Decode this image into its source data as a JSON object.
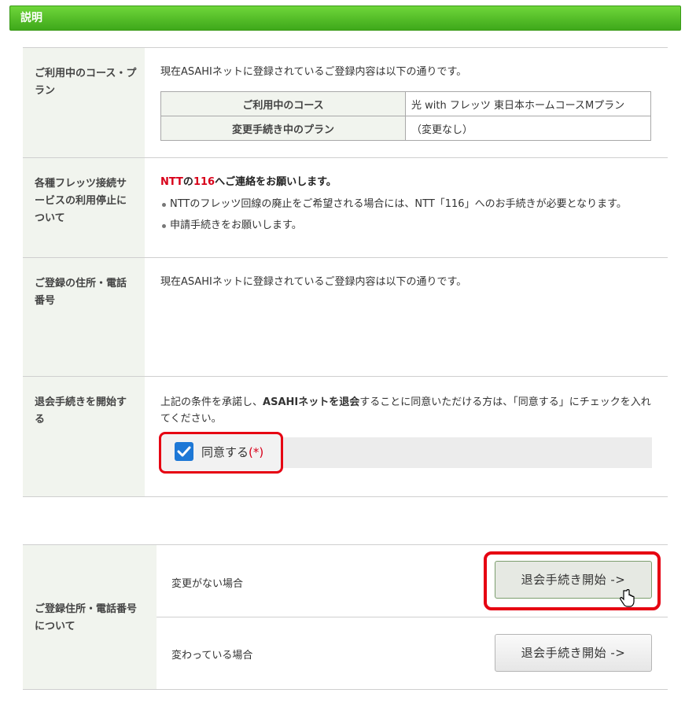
{
  "header": {
    "title": "説明"
  },
  "course": {
    "label": "ご利用中のコース・プラン",
    "intro": "現在ASAHIネットに登録されているご登録内容は以下の通りです。",
    "table": [
      {
        "key": "ご利用中のコース",
        "value": "光 with フレッツ 東日本ホームコースMプラン"
      },
      {
        "key": "変更手続き中のプラン",
        "value": "（変更なし）"
      }
    ]
  },
  "flets": {
    "label": "各種フレッツ接続サービスの利用停止について",
    "warn_ntt": "NTT",
    "warn_mid": "の",
    "warn_num": "116",
    "warn_rest": "へご連絡をお願いします。",
    "bullets": [
      "NTTのフレッツ回線の廃止をご希望される場合には、NTT「116」へのお手続きが必要となります。",
      "申請手続きをお願いします。"
    ]
  },
  "address": {
    "label": "ご登録の住所・電話番号",
    "text": "現在ASAHIネットに登録されているご登録内容は以下の通りです。"
  },
  "withdraw": {
    "label": "退会手続きを開始する",
    "text_pre": "上記の条件を承諾し、",
    "text_bold": "ASAHIネットを退会",
    "text_post": "することに同意いただける方は、「同意する」にチェックを入れてください。",
    "agree_label": "同意する",
    "agree_required": "(*)",
    "agree_checked": true
  },
  "address_change": {
    "label": "ご登録住所・電話番号について",
    "rows": [
      {
        "text": "変更がない場合",
        "button": "退会手続き開始 ->"
      },
      {
        "text": "変わっている場合",
        "button": "退会手続き開始 ->"
      }
    ]
  },
  "colors": {
    "header_green": "#4cba25",
    "highlight_red": "#e60012",
    "label_bg": "#f1f4ee",
    "checkbox_blue": "#1e78d6"
  }
}
